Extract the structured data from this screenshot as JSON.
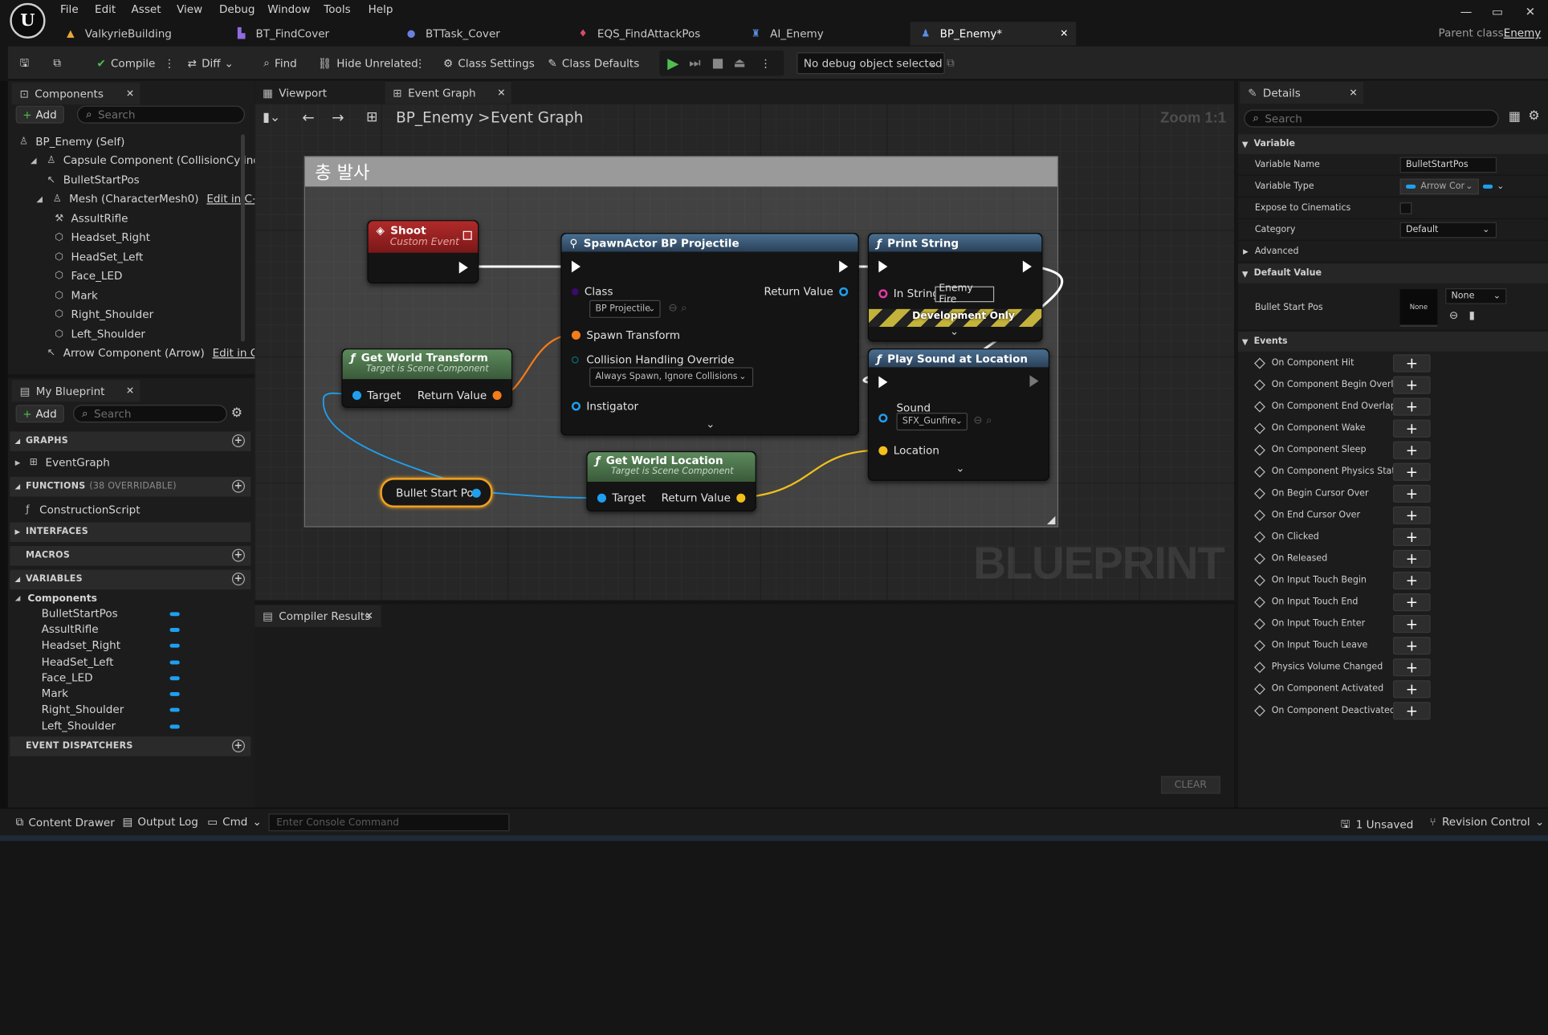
{
  "menu": {
    "logo": "U",
    "items": [
      "File",
      "Edit",
      "Asset",
      "View",
      "Debug",
      "Window",
      "Tools",
      "Help"
    ]
  },
  "window_controls": {
    "minimize": "—",
    "restore": "▭",
    "close": "✕"
  },
  "doc_tabs": [
    {
      "label": "ValkyrieBuilding",
      "icon": "level-icon"
    },
    {
      "label": "BT_FindCover",
      "icon": "behavior-tree-icon"
    },
    {
      "label": "BTTask_Cover",
      "icon": "task-icon"
    },
    {
      "label": "EQS_FindAttackPos",
      "icon": "eqs-icon"
    },
    {
      "label": "AI_Enemy",
      "icon": "ai-icon"
    },
    {
      "label": "BP_Enemy*",
      "icon": "blueprint-icon",
      "active": true,
      "close": "✕"
    }
  ],
  "parent_class": {
    "label": "Parent class:",
    "value": "Enemy"
  },
  "toolbar": {
    "compile": "Compile",
    "diff": "Diff",
    "find": "Find",
    "hide_unrelated": "Hide Unrelated",
    "class_settings": "Class Settings",
    "class_defaults": "Class Defaults",
    "debug_object": "No debug object selected"
  },
  "components_panel": {
    "title": "Components",
    "add": "Add",
    "search_placeholder": "Search",
    "items": [
      {
        "label": "BP_Enemy (Self)",
        "icon": "person-icon"
      },
      {
        "label": "Capsule Component (CollisionCylinder)",
        "icon": "capsule-icon"
      },
      {
        "label": "BulletStartPos",
        "icon": "arrow-icon"
      },
      {
        "label": "Mesh (CharacterMesh0)",
        "icon": "skeleton-icon",
        "edit": "Edit in C++"
      },
      {
        "label": "AssultRifle",
        "icon": "skeleton-icon"
      },
      {
        "label": "Headset_Right",
        "icon": "mesh-icon"
      },
      {
        "label": "HeadSet_Left",
        "icon": "mesh-icon"
      },
      {
        "label": "Face_LED",
        "icon": "mesh-icon"
      },
      {
        "label": "Mark",
        "icon": "mesh-icon"
      },
      {
        "label": "Right_Shoulder",
        "icon": "mesh-icon"
      },
      {
        "label": "Left_Shoulder",
        "icon": "mesh-icon"
      },
      {
        "label": "Arrow Component (Arrow)",
        "icon": "arrow-icon",
        "edit": "Edit in C++"
      }
    ]
  },
  "my_blueprint": {
    "title": "My Blueprint",
    "add": "Add",
    "search_placeholder": "Search",
    "graphs": "GRAPHS",
    "event_graph": "EventGraph",
    "functions": "FUNCTIONS",
    "functions_note": "(38 OVERRIDABLE)",
    "construction_script": "ConstructionScript",
    "interfaces": "INTERFACES",
    "macros": "MACROS",
    "variables": "VARIABLES",
    "components_group": "Components",
    "vars": [
      "BulletStartPos",
      "AssultRifle",
      "Headset_Right",
      "HeadSet_Left",
      "Face_LED",
      "Mark",
      "Right_Shoulder",
      "Left_Shoulder"
    ],
    "event_dispatchers": "EVENT DISPATCHERS"
  },
  "graph_tabs": {
    "viewport": "Viewport",
    "event_graph": "Event Graph"
  },
  "graph": {
    "breadcrumb_root": "BP_Enemy",
    "breadcrumb_sep": ">",
    "breadcrumb_leaf": "Event Graph",
    "zoom": "Zoom 1:1",
    "watermark": "BLUEPRINT",
    "comment": "총 발사",
    "shoot": {
      "title": "Shoot",
      "subtitle": "Custom Event"
    },
    "spawn": {
      "title": "SpawnActor BP Projectile",
      "class": "Class",
      "class_value": "BP Projectile",
      "return_value": "Return Value",
      "spawn_transform": "Spawn Transform",
      "collision": "Collision Handling Override",
      "collision_value": "Always Spawn, Ignore Collisions",
      "instigator": "Instigator"
    },
    "print": {
      "title": "Print String",
      "in_string": "In String",
      "in_string_value": "Enemy Fire",
      "dev_only": "Development Only"
    },
    "transform": {
      "title": "Get World Transform",
      "subtitle": "Target is Scene Component",
      "target": "Target",
      "return_value": "Return Value"
    },
    "location": {
      "title": "Get World Location",
      "subtitle": "Target is Scene Component",
      "target": "Target",
      "return_value": "Return Value"
    },
    "sound": {
      "title": "Play Sound at Location",
      "sound": "Sound",
      "sound_value": "SFX_Gunfire",
      "location": "Location"
    },
    "var_node": "Bullet Start Pos"
  },
  "compiler": {
    "title": "Compiler Results",
    "clear": "CLEAR"
  },
  "details": {
    "title": "Details",
    "search_placeholder": "Search",
    "variable_section": "Variable",
    "variable_name_label": "Variable Name",
    "variable_name": "BulletStartPos",
    "variable_type_label": "Variable Type",
    "variable_type": "Arrow Cor",
    "expose_label": "Expose to Cinematics",
    "category_label": "Category",
    "category": "Default",
    "advanced": "Advanced",
    "default_value_section": "Default Value",
    "bullet_start_pos_label": "Bullet Start Pos",
    "thumb_none": "None",
    "none_combo": "None",
    "events_section": "Events",
    "events": [
      "On Component Hit",
      "On Component Begin Overlap",
      "On Component End Overlap",
      "On Component Wake",
      "On Component Sleep",
      "On Component Physics State",
      "On Begin Cursor Over",
      "On End Cursor Over",
      "On Clicked",
      "On Released",
      "On Input Touch Begin",
      "On Input Touch End",
      "On Input Touch Enter",
      "On Input Touch Leave",
      "Physics Volume Changed",
      "On Component Activated",
      "On Component Deactivated"
    ]
  },
  "bottom": {
    "content_drawer": "Content Drawer",
    "output_log": "Output Log",
    "cmd": "Cmd",
    "console_placeholder": "Enter Console Command",
    "unsaved": "1 Unsaved",
    "revision_control": "Revision Control"
  },
  "colors": {
    "accent_blue": "#1ea0ee",
    "event_red": "#a31f1f",
    "function_blue": "#3a5f80",
    "pure_green": "#4d6a4d",
    "exec_white": "#ffffff",
    "object_pin": "#1ea0ee",
    "vector_pin": "#f2c01a",
    "transform_pin": "#f57c1a"
  }
}
